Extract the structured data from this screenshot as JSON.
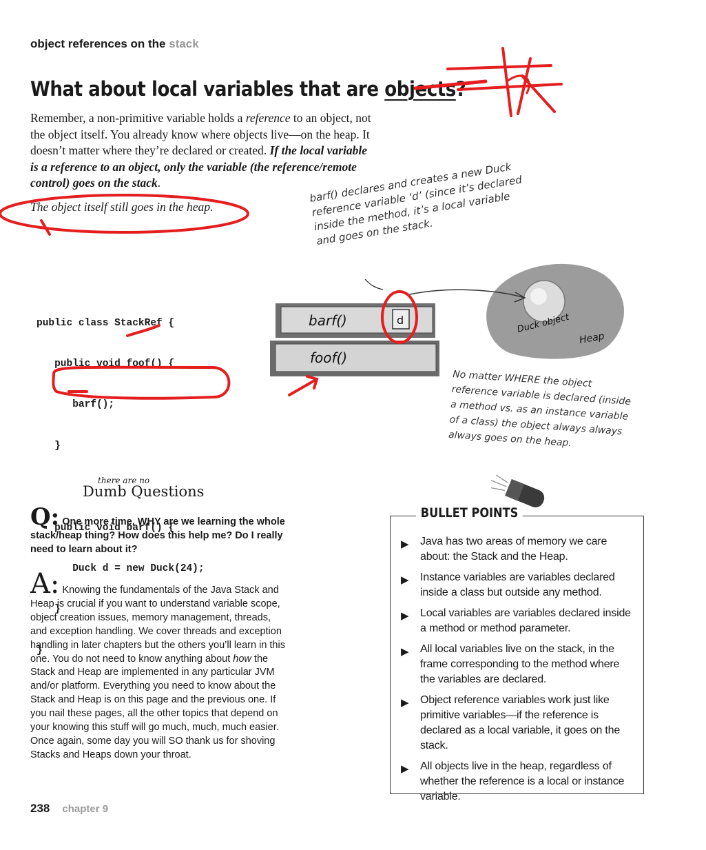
{
  "header": {
    "prefix": "object references on the ",
    "accent": "stack"
  },
  "title": {
    "pre": "What about local variables that are ",
    "underlined": "objects",
    "post": "?"
  },
  "intro": {
    "p1": "Remember, a non-primitive variable holds a ",
    "p1_italic": "reference",
    "p2": " to an object, not the object itself. You already know where objects live—on the heap. It doesn’t matter where they’re declared or created. ",
    "bold_italic": "If the local variable is a reference to an object, only the variable (the reference/remote control) goes on the stack",
    "end": ".",
    "p3": "The object itself still goes in the heap."
  },
  "code": {
    "lines": [
      "public class StackRef {",
      "   public void foof() {",
      "      barf();",
      "   }",
      "",
      "   public void barf() {",
      "      Duck d = new Duck(24);",
      "   }",
      "}"
    ]
  },
  "diagram": {
    "frame_top": "barf()",
    "frame_bottom": "foof()",
    "var_label": "d",
    "object_label": "Duck object",
    "heap_label": "Heap",
    "note_top": "barf() declares and creates a new Duck reference variable ‘d’ (since it’s declared inside the method, it’s a local variable and goes on the stack.",
    "note_bottom": "No matter WHERE the object reference variable is declared (inside a method vs. as an instance variable of a class) the object always always always goes on the heap."
  },
  "dumb": {
    "small": "there are no",
    "big": "Dumb Questions"
  },
  "qa": {
    "q_letter": "Q:",
    "q_text": "One more time, WHY are we learning the whole stack/heap thing? How does this help me? Do I really need to learn about it?",
    "a_letter": "A:",
    "a_1": "Knowing the fundamentals of the Java Stack and Heap is crucial if you want to understand variable scope, object creation issues, memory management, threads, and exception handling. We cover threads and exception handling in later chapters but the others you’ll learn in this one. You do not need to know anything about ",
    "a_italic": "how",
    "a_2": " the Stack and Heap are implemented in any particular JVM and/or platform. Everything you need to know about the Stack and Heap is on this page and the previous one. If you nail these pages, all the other topics that depend on your knowing this stuff will go much, much, much easier. Once again, some day you will SO thank us for shoving Stacks and Heaps down your throat."
  },
  "bullets": {
    "title": "BULLET POINTS",
    "items": [
      "Java has two areas of memory we care about: the Stack and the Heap.",
      "Instance variables are variables declared inside a class but outside any method.",
      "Local variables are variables declared inside a method or method parameter.",
      "All local variables live on the stack, in the frame corresponding to the method where the variables are declared.",
      "Object reference variables work just like primitive variables—if the reference is declared as a local variable, it goes on the stack.",
      "All objects live in the heap, regardless of whether the reference is a local or instance variable."
    ]
  },
  "footer": {
    "page": "238",
    "chapter": "chapter 9"
  },
  "colors": {
    "annotation_red": "#e41e1e",
    "accent_grey": "#9a9a9a",
    "heap_grey": "#9c9c9c"
  }
}
